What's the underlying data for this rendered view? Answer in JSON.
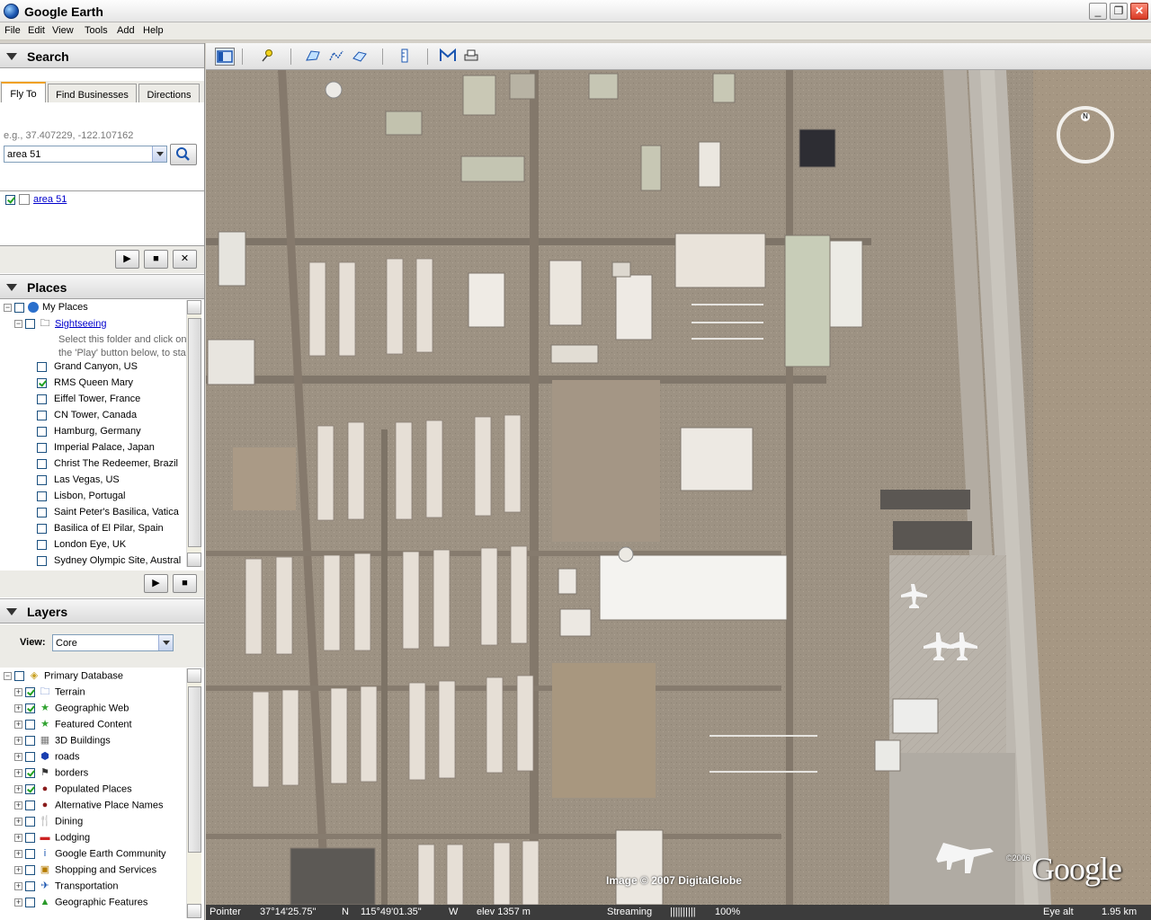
{
  "window": {
    "title": "Google Earth"
  },
  "menu": [
    "File",
    "Edit",
    "View",
    "Tools",
    "Add",
    "Help"
  ],
  "search": {
    "header": "Search",
    "tabs": [
      "Fly To",
      "Find Businesses",
      "Directions"
    ],
    "hint": "e.g., 37.407229, -122.107162",
    "value": "area 51",
    "results": [
      "area 51"
    ]
  },
  "places": {
    "header": "Places",
    "my_places": "My Places",
    "folder": "Sightseeing",
    "folder_note_1": "Select this folder and click on",
    "folder_note_2": "the 'Play' button below, to sta",
    "items": [
      {
        "label": "Grand Canyon, US",
        "checked": false
      },
      {
        "label": "RMS Queen Mary",
        "checked": true
      },
      {
        "label": "Eiffel Tower, France",
        "checked": false
      },
      {
        "label": "CN Tower, Canada",
        "checked": false
      },
      {
        "label": "Hamburg, Germany",
        "checked": false
      },
      {
        "label": "Imperial Palace, Japan",
        "checked": false
      },
      {
        "label": "Christ The Redeemer, Brazil",
        "checked": false
      },
      {
        "label": "Las Vegas, US",
        "checked": false
      },
      {
        "label": "Lisbon, Portugal",
        "checked": false
      },
      {
        "label": "Saint Peter's Basilica, Vatica",
        "checked": false
      },
      {
        "label": "Basilica of El Pilar, Spain",
        "checked": false
      },
      {
        "label": "London Eye, UK",
        "checked": false
      },
      {
        "label": "Sydney Olympic Site, Austral",
        "checked": false
      }
    ]
  },
  "layers": {
    "header": "Layers",
    "view_label": "View:",
    "view_value": "Core",
    "root": "Primary Database",
    "items": [
      {
        "label": "Terrain",
        "checked": true,
        "icon": "folder-icon"
      },
      {
        "label": "Geographic Web",
        "checked": true,
        "icon": "star-icon"
      },
      {
        "label": "Featured Content",
        "checked": false,
        "icon": "star-icon"
      },
      {
        "label": "3D Buildings",
        "checked": false,
        "icon": "building-icon"
      },
      {
        "label": "roads",
        "checked": false,
        "icon": "road-shield-icon"
      },
      {
        "label": "borders",
        "checked": true,
        "icon": "flag-icon"
      },
      {
        "label": "Populated Places",
        "checked": true,
        "icon": "dot-icon"
      },
      {
        "label": "Alternative Place Names",
        "checked": false,
        "icon": "dot-icon"
      },
      {
        "label": "Dining",
        "checked": false,
        "icon": "fork-icon"
      },
      {
        "label": "Lodging",
        "checked": false,
        "icon": "bed-icon"
      },
      {
        "label": "Google Earth Community",
        "checked": false,
        "icon": "info-icon"
      },
      {
        "label": "Shopping and Services",
        "checked": false,
        "icon": "cart-icon"
      },
      {
        "label": "Transportation",
        "checked": false,
        "icon": "plane-icon"
      },
      {
        "label": "Geographic Features",
        "checked": false,
        "icon": "mountain-icon"
      }
    ]
  },
  "map": {
    "credit": "Image © 2007 DigitalGlobe",
    "logo": "Google",
    "logo_year": "©2006",
    "compass_n": "N"
  },
  "status": {
    "pointer_label": "Pointer",
    "lat": "37°14'25.75\"",
    "lat_dir": "N",
    "lon": "115°49'01.35\"",
    "lon_dir": "W",
    "elev": "elev  1357 m",
    "streaming_label": "Streaming",
    "streaming_bar": "||||||||||",
    "streaming_pct": "100%",
    "eye_label": "Eye alt",
    "eye_value": "1.95 km"
  }
}
